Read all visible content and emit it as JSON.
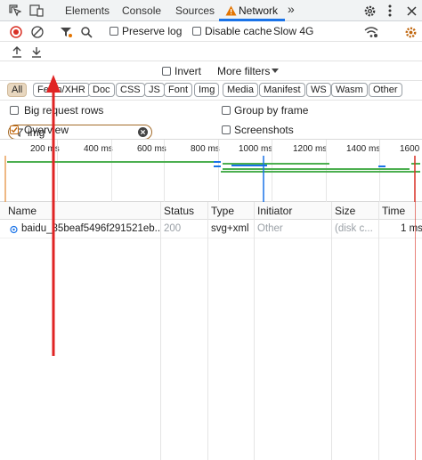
{
  "tabs": {
    "elements": "Elements",
    "console": "Console",
    "sources": "Sources",
    "network": "Network",
    "more": "»"
  },
  "toolbar": {
    "preserve_log": "Preserve log",
    "disable_cache": "Disable cache",
    "throttling": "Slow 4G"
  },
  "filter": {
    "value": "img",
    "invert": "Invert",
    "more_filters": "More filters"
  },
  "chips": [
    "All",
    "Fetch/XHR",
    "Doc",
    "CSS",
    "JS",
    "Font",
    "Img",
    "Media",
    "Manifest",
    "WS",
    "Wasm",
    "Other"
  ],
  "options": {
    "big_request_rows": "Big request rows",
    "group_by_frame": "Group by frame",
    "overview": "Overview",
    "screenshots": "Screenshots"
  },
  "timeline": {
    "ticks": [
      "200 ms",
      "400 ms",
      "600 ms",
      "800 ms",
      "1000 ms",
      "1200 ms",
      "1400 ms",
      "1600 ms"
    ]
  },
  "table": {
    "headers": {
      "name": "Name",
      "status": "Status",
      "type": "Type",
      "initiator": "Initiator",
      "size": "Size",
      "time": "Time"
    },
    "rows": [
      {
        "name": "baidu_85beaf5496f291521eb...",
        "status": "200",
        "type": "svg+xml",
        "initiator": "Other",
        "size": "(disk c...",
        "time": "1 ms"
      }
    ]
  },
  "colors": {
    "accent_orange": "#c0670f",
    "warning": "#e37400",
    "annotation_red": "#e02424"
  }
}
